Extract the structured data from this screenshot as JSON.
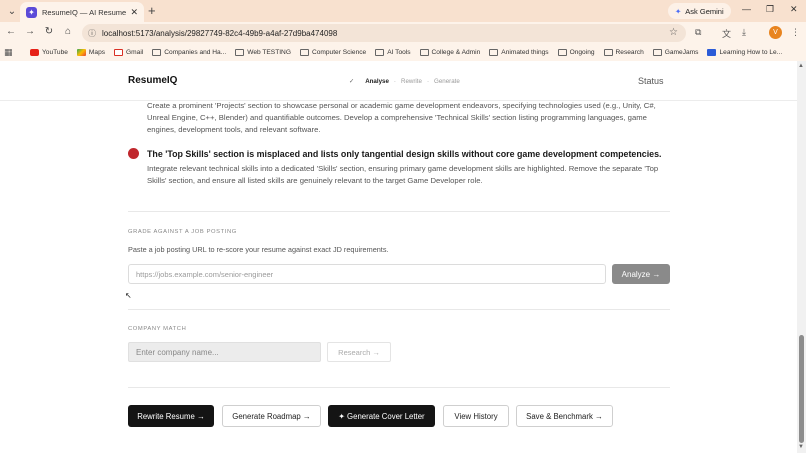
{
  "browser": {
    "tab_title": "ResumeIQ — AI Resume Analy",
    "tab_favicon": "sparkle-icon",
    "ask_gemini": "Ask Gemini",
    "url": "localhost:5173/analysis/29827749-82c4-49b9-a4af-27d9ba474098",
    "profile_initial": "V",
    "bookmarks": [
      {
        "label": "YouTube",
        "icon": "youtube-icon"
      },
      {
        "label": "Maps",
        "icon": "maps-icon"
      },
      {
        "label": "Gmail",
        "icon": "gmail-icon"
      },
      {
        "label": "Companies and Ha...",
        "icon": "folder-icon"
      },
      {
        "label": "Web TESTING",
        "icon": "folder-icon"
      },
      {
        "label": "Computer Science",
        "icon": "folder-icon"
      },
      {
        "label": "AI Tools",
        "icon": "folder-icon"
      },
      {
        "label": "College & Admin",
        "icon": "folder-icon"
      },
      {
        "label": "Animated things",
        "icon": "folder-icon"
      },
      {
        "label": "Ongoing",
        "icon": "folder-icon"
      },
      {
        "label": "Research",
        "icon": "folder-icon"
      },
      {
        "label": "GameJams",
        "icon": "folder-icon"
      },
      {
        "label": "Learning How to Le...",
        "icon": "bookmark-icon"
      }
    ]
  },
  "header": {
    "brand": "ResumeIQ",
    "steps": {
      "check": "✓",
      "analyse": "Analyse",
      "rewrite": "Rewrite",
      "generate": "Generate"
    },
    "status": "Status"
  },
  "issues": {
    "prev_text": "Create a prominent 'Projects' section to showcase personal or academic game development endeavors, specifying technologies used (e.g., Unity, C#, Unreal Engine, C++, Blender) and quantifiable outcomes. Develop a comprehensive 'Technical Skills' section listing programming languages, game engines, development tools, and relevant software.",
    "title": "The 'Top Skills' section is misplaced and lists only tangential design skills without core game development competencies.",
    "text": "Integrate relevant technical skills into a dedicated 'Skills' section, ensuring primary game development skills are highlighted. Remove the separate 'Top Skills' section, and ensure all listed skills are genuinely relevant to the target Game Developer role.",
    "severity_color": "#c0272d"
  },
  "job_posting": {
    "label": "GRADE AGAINST A JOB POSTING",
    "desc": "Paste a job posting URL to re-score your resume against exact JD requirements.",
    "placeholder": "https://jobs.example.com/senior-engineer",
    "analyze_label": "Analyze →"
  },
  "company": {
    "label": "COMPANY MATCH",
    "placeholder": "Enter company name...",
    "research_label": "Research →"
  },
  "actions": {
    "rewrite": "Rewrite Resume →",
    "roadmap": "Generate Roadmap →",
    "cover_letter": "✦ Generate Cover Letter",
    "history": "View History",
    "benchmark": "Save & Benchmark →"
  }
}
